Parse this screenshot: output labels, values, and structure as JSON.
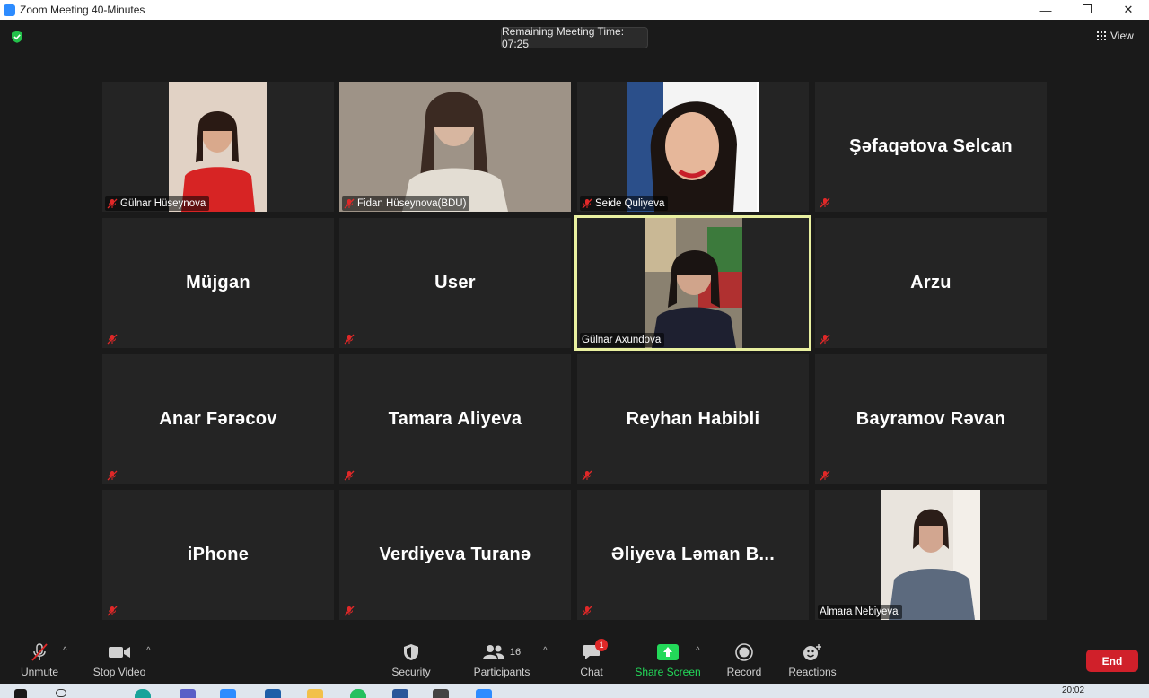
{
  "window": {
    "title": "Zoom Meeting 40-Minutes",
    "controls": [
      "—",
      "❐",
      "✕"
    ]
  },
  "meeting": {
    "remaining_time": "Remaining Meeting Time: 07:25",
    "view_label": "View"
  },
  "participants": [
    {
      "name": "Gülnar Hüseynova",
      "video": true
    },
    {
      "name": "Fidan Hüseynova(BDU)",
      "video": true
    },
    {
      "name": "Seide Quliyeva",
      "video": true
    },
    {
      "name": "Şəfaqətova Selcan",
      "video": false
    },
    {
      "name": "Müjgan",
      "video": false
    },
    {
      "name": "User",
      "video": false
    },
    {
      "name": "Gülnar Axundova",
      "video": true,
      "active_speaker": true
    },
    {
      "name": "Arzu",
      "video": false
    },
    {
      "name": "Anar Fərəcov",
      "video": false
    },
    {
      "name": "Tamara Aliyeva",
      "video": false
    },
    {
      "name": "Reyhan Habibli",
      "video": false
    },
    {
      "name": "Bayramov Rəvan",
      "video": false
    },
    {
      "name": "iPhone",
      "video": false
    },
    {
      "name": "Verdiyeva Turanə",
      "video": false
    },
    {
      "name": "Əliyeva Ləman B...",
      "video": false
    },
    {
      "name": "Almara Nebiyeva",
      "video": true
    }
  ],
  "toolbar": {
    "unmute": "Unmute",
    "stop_video": "Stop Video",
    "security": "Security",
    "participants": "Participants",
    "participants_count": "16",
    "chat": "Chat",
    "chat_badge": "1",
    "share_screen": "Share Screen",
    "record": "Record",
    "reactions": "Reactions",
    "end": "End"
  },
  "taskbar": {
    "clock": "20:02"
  },
  "colors": {
    "share_green": "#23d959",
    "end_red": "#d0202a",
    "active_speaker_border": "#e9f0a0",
    "mute_red": "#e02828"
  }
}
